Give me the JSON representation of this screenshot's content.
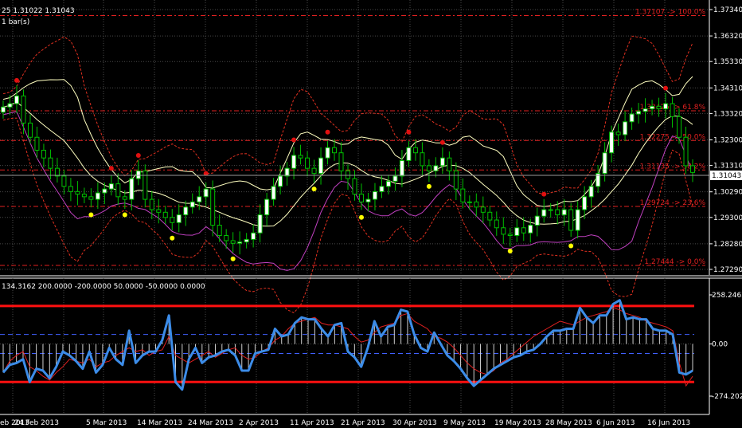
{
  "header": {
    "price_info": "25  1.31022 1.31043",
    "bars_info": "1 bar(s)"
  },
  "sub_header": {
    "info": "134.3162 200.0000 -200.0000 50.0000 -50.0000 0.0000"
  },
  "colors": {
    "background": "#000000",
    "grid": "#4a4a4a",
    "candle_bull": "#ffffff",
    "candle_bear": "#000000",
    "candle_wick": "#00c000",
    "fibo": "#e02020",
    "bb_inner": "#ffffc0",
    "bb_outer": "#e03020",
    "support_line": "#c040c0",
    "dot_red": "#e01010",
    "dot_yellow": "#ffff00",
    "cci": "#3c8ce8",
    "cci_signal": "#e02020",
    "level_limit": "#ff1010",
    "level_dashed": "#4060ff"
  },
  "chart_data": [
    {
      "type": "candlestick",
      "name": "price",
      "ylim": [
        1.2729,
        1.3734
      ],
      "y_ticks": [
        "1.37340",
        "1.36320",
        "1.35330",
        "1.34310",
        "1.33320",
        "1.32300",
        "1.31310",
        "1.30290",
        "1.29300",
        "1.28280",
        "1.27290"
      ],
      "current_price": "1.31043",
      "x_ticks": [
        "eb 2013",
        "24 Feb 2013",
        "5 Mar 2013",
        "14 Mar 2013",
        "24 Mar 2013",
        "2 Apr 2013",
        "11 Apr 2013",
        "21 Apr 2013",
        "30 Apr 2013",
        "9 May 2013",
        "19 May 2013",
        "28 May 2013",
        "6 Jun 2013",
        "16 Jun 2013"
      ],
      "fibo_levels": [
        {
          "price": 1.37107,
          "label": "1.37107 -> 100.0%"
        },
        {
          "price": 1.33425,
          "label": "1.33425 -> 61.8%"
        },
        {
          "price": 1.32275,
          "label": "1.32275 -> 50.0%"
        },
        {
          "price": 1.31135,
          "label": "1.31135 -> 38.2%"
        },
        {
          "price": 1.29724,
          "label": "1.29724 -> 23.6%"
        },
        {
          "price": 1.27444,
          "label": "1.27444 -> 0.0%"
        }
      ],
      "closes": [
        1.3357,
        1.337,
        1.34,
        1.3295,
        1.324,
        1.319,
        1.316,
        1.312,
        1.309,
        1.305,
        1.303,
        1.302,
        1.301,
        1.3,
        1.3025,
        1.304,
        1.306,
        1.301,
        1.3,
        1.308,
        1.311,
        1.3,
        1.296,
        1.295,
        1.293,
        1.291,
        1.294,
        1.297,
        1.299,
        1.301,
        1.304,
        1.29,
        1.286,
        1.284,
        1.283,
        1.2835,
        1.2845,
        1.287,
        1.294,
        1.3,
        1.305,
        1.309,
        1.312,
        1.317,
        1.316,
        1.312,
        1.31,
        1.316,
        1.32,
        1.318,
        1.311,
        1.308,
        1.302,
        1.299,
        1.3,
        1.303,
        1.305,
        1.307,
        1.309,
        1.315,
        1.32,
        1.318,
        1.313,
        1.311,
        1.313,
        1.316,
        1.311,
        1.304,
        1.299,
        1.299,
        1.297,
        1.295,
        1.292,
        1.289,
        1.2865,
        1.286,
        1.289,
        1.287,
        1.29,
        1.2935,
        1.296,
        1.296,
        1.294,
        1.296,
        1.288,
        1.296,
        1.301,
        1.305,
        1.31,
        1.318,
        1.326,
        1.325,
        1.33,
        1.333,
        1.334,
        1.335,
        1.336,
        1.335,
        1.337,
        1.332,
        1.324,
        1.313,
        1.3104
      ],
      "cci_panel": {
        "ylim": [
          -274.2022,
          258.2462
        ],
        "y_ticks": [
          "258.2462",
          "0.00",
          "-274.2022"
        ],
        "levels": [
          200,
          50,
          -50,
          -200
        ],
        "cci": [
          -150,
          -110,
          -100,
          -80,
          -200,
          -130,
          -140,
          -180,
          -120,
          -40,
          -60,
          -90,
          -130,
          -40,
          -150,
          -110,
          -20,
          -80,
          -110,
          70,
          -100,
          -60,
          -40,
          -40,
          20,
          150,
          -200,
          -240,
          -80,
          -20,
          -100,
          -70,
          -60,
          -40,
          -30,
          -60,
          -140,
          -140,
          -50,
          -40,
          -30,
          80,
          40,
          50,
          110,
          140,
          130,
          130,
          80,
          40,
          100,
          110,
          -40,
          -70,
          -120,
          -20,
          120,
          40,
          90,
          100,
          180,
          170,
          50,
          -20,
          -40,
          60,
          0,
          -60,
          -90,
          -130,
          -180,
          -220,
          -190,
          -160,
          -130,
          -110,
          -90,
          -70,
          -60,
          -40,
          -30,
          0,
          40,
          70,
          70,
          80,
          80,
          190,
          140,
          110,
          150,
          150,
          210,
          230,
          130,
          140,
          130,
          130,
          80,
          70,
          70,
          50,
          -150,
          -160,
          -140
        ]
      },
      "cci_signal_series": [
        -150,
        -90,
        -60,
        -40,
        -120,
        -140,
        -170,
        -190,
        -150,
        -120,
        -80,
        -90,
        -100,
        -80,
        -120,
        -100,
        -90,
        -60,
        -40,
        -20,
        -40,
        -30,
        -60,
        -40,
        -30,
        40,
        -60,
        -80,
        -100,
        -80,
        -60,
        -40,
        -70,
        -50,
        -30,
        -20,
        -60,
        -80,
        -70,
        -40,
        -20,
        20,
        40,
        80,
        110,
        120,
        130,
        140,
        110,
        100,
        100,
        90,
        80,
        40,
        10,
        20,
        60,
        90,
        100,
        110,
        150,
        160,
        120,
        100,
        80,
        40,
        30,
        10,
        -20,
        -60,
        -100,
        -130,
        -150,
        -160,
        -140,
        -100,
        -80,
        -50,
        -20,
        10,
        40,
        60,
        80,
        100,
        120,
        110,
        100,
        120,
        140,
        150,
        160,
        170,
        190,
        180,
        160,
        150,
        140,
        120,
        110,
        100,
        90,
        70,
        -100,
        -220,
        -170
      ]
    }
  ]
}
